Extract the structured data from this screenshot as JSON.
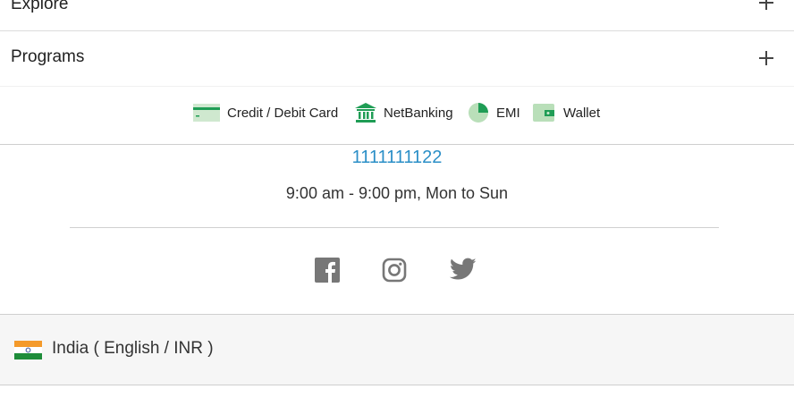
{
  "accordion": {
    "explore_label": "Explore",
    "programs_label": "Programs"
  },
  "payments": {
    "card_label": "Credit / Debit Card",
    "netbanking_label": "NetBanking",
    "emi_label": "EMI",
    "wallet_label": "Wallet"
  },
  "contact": {
    "phone": "1111111122",
    "hours": "9:00 am - 9:00 pm, Mon to Sun"
  },
  "social": {
    "icons": [
      "facebook-icon",
      "instagram-icon",
      "twitter-icon"
    ]
  },
  "locale": {
    "label": "India ( English / INR )",
    "flag_icon": "india-flag-icon"
  },
  "colors": {
    "link": "#2b8fc7",
    "payment_green": "#1f9d55",
    "social_gray": "#777777"
  }
}
